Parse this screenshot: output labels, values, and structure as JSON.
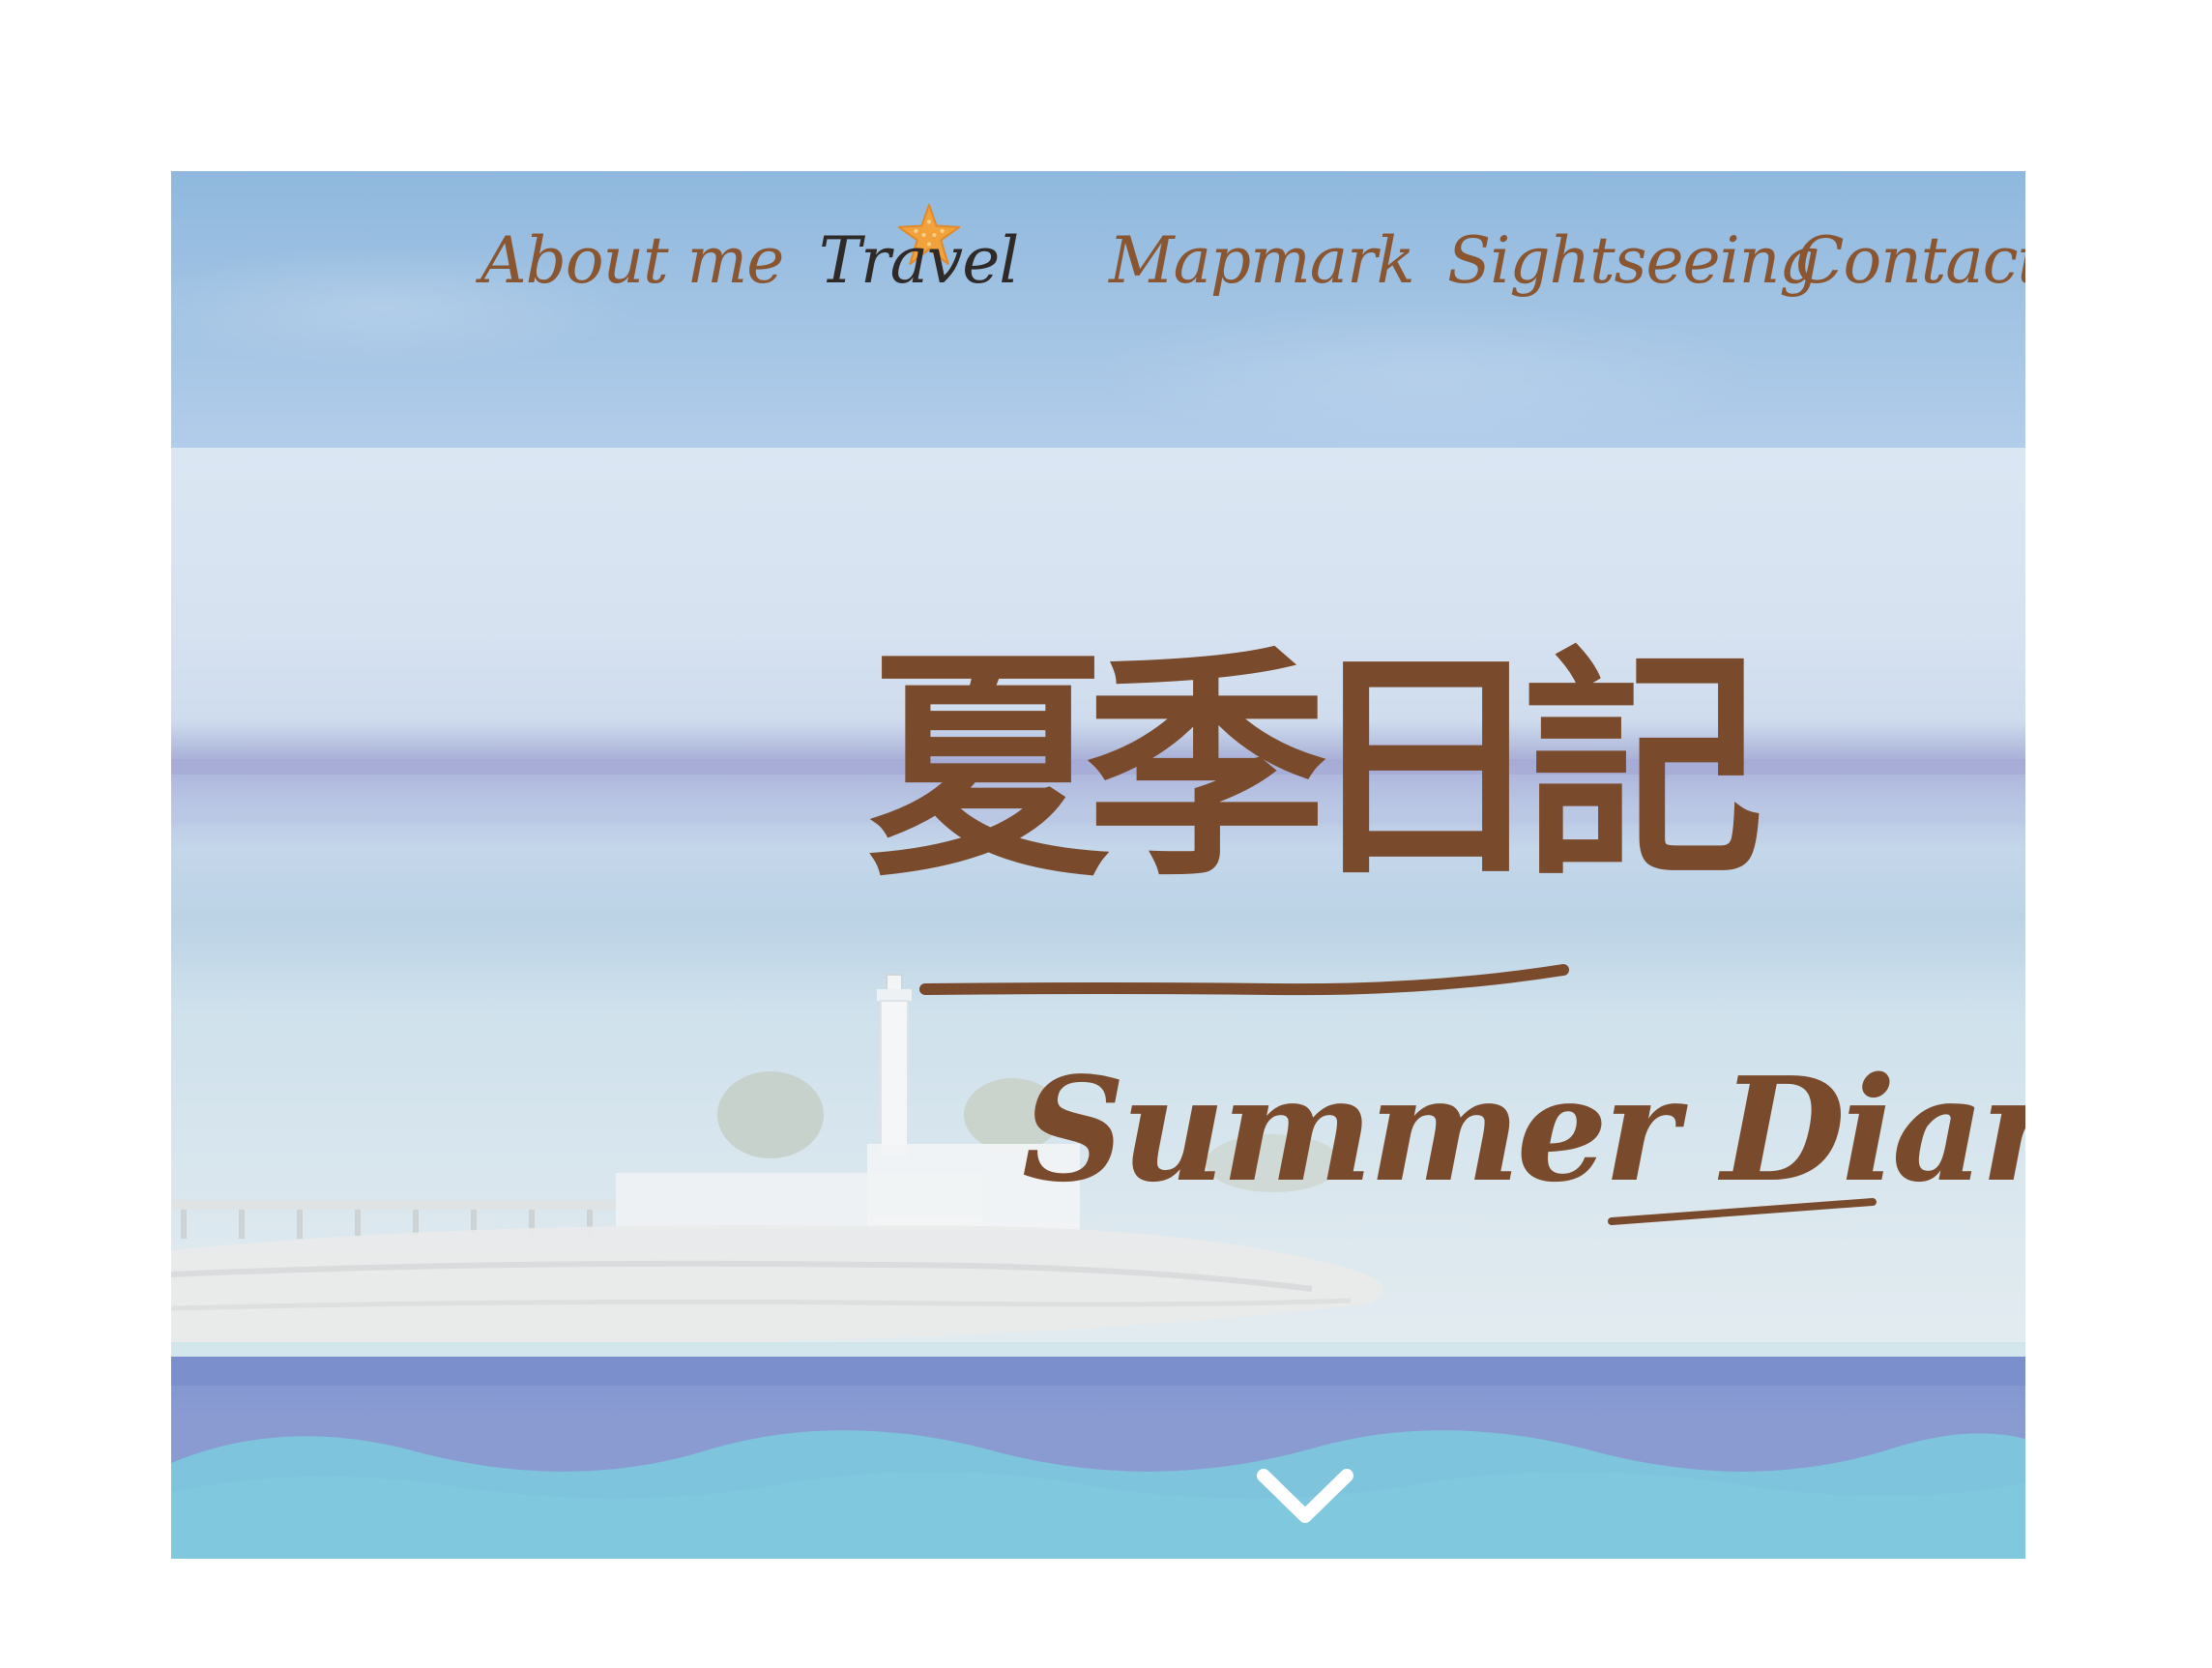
{
  "nav": {
    "items": [
      {
        "label": "About me",
        "active": false
      },
      {
        "label": "Travel",
        "active": true
      },
      {
        "label": "Mapmark",
        "active": false
      },
      {
        "label": "Sightseeing",
        "active": false
      },
      {
        "label": "Contact m",
        "active": false
      }
    ],
    "active_marker_icon": "starfish-icon"
  },
  "hero": {
    "title_jp": "夏季日記",
    "title_en": "Summer Diary"
  },
  "scroll_icon": "chevron-down-icon",
  "colors": {
    "nav_text": "#8a5631",
    "nav_text_active": "#2f2a28",
    "title_text": "#7a4a2c",
    "sky": "#a3c4e4",
    "sea": "#7fc6dc",
    "starfish": "#f0a640"
  }
}
